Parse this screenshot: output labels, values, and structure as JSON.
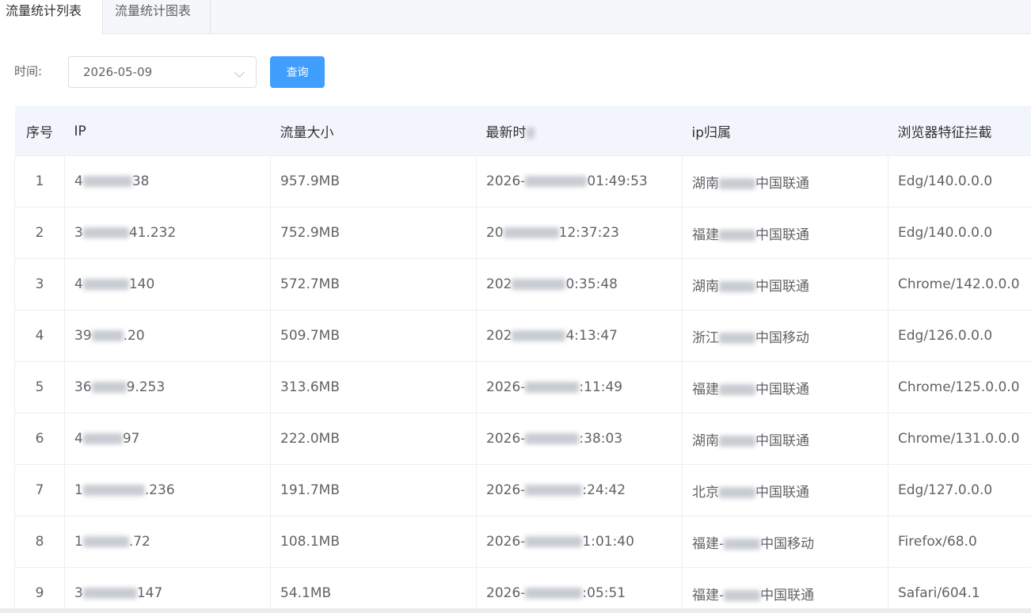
{
  "tabs": [
    {
      "label": "流量统计列表"
    },
    {
      "label": "流量统计图表"
    }
  ],
  "filter": {
    "time_label": "时间:",
    "date_value": "2026-05-09",
    "query_label": "查询"
  },
  "table": {
    "headers": [
      "序号",
      "IP",
      "流量大小",
      "最新时",
      "ip归属",
      "浏览器特征拦截"
    ],
    "rows": [
      {
        "index": "1",
        "ip_pre": "4",
        "ip_post": "38",
        "traffic": "957.9MB",
        "time_pre": "2026-",
        "time_post": "01:49:53",
        "region_pre": "湖南",
        "region_post": "中国联通",
        "browser": "Edg/140.0.0.0"
      },
      {
        "index": "2",
        "ip_pre": "3",
        "ip_post": "41.232",
        "traffic": "752.9MB",
        "time_pre": "20",
        "time_post": "12:37:23",
        "region_pre": "福建",
        "region_post": "中国联通",
        "browser": "Edg/140.0.0.0"
      },
      {
        "index": "3",
        "ip_pre": "4",
        "ip_post": "140",
        "traffic": "572.7MB",
        "time_pre": "202",
        "time_post": "0:35:48",
        "region_pre": "湖南",
        "region_post": "中国联通",
        "browser": "Chrome/142.0.0.0"
      },
      {
        "index": "4",
        "ip_pre": "39",
        "ip_post": ".20",
        "traffic": "509.7MB",
        "time_pre": "202",
        "time_post": "4:13:47",
        "region_pre": "浙江",
        "region_post": "中国移动",
        "browser": "Edg/126.0.0.0"
      },
      {
        "index": "5",
        "ip_pre": "36",
        "ip_post": "9.253",
        "traffic": "313.6MB",
        "time_pre": "2026-",
        "time_post": ":11:49",
        "region_pre": "福建",
        "region_post": "中国联通",
        "browser": "Chrome/125.0.0.0"
      },
      {
        "index": "6",
        "ip_pre": "4",
        "ip_post": "97",
        "traffic": "222.0MB",
        "time_pre": "2026-",
        "time_post": ":38:03",
        "region_pre": "湖南",
        "region_post": "中国联通",
        "browser": "Chrome/131.0.0.0"
      },
      {
        "index": "7",
        "ip_pre": "1",
        "ip_post": ".236",
        "traffic": "191.7MB",
        "time_pre": "2026-",
        "time_post": ":24:42",
        "region_pre": "北京",
        "region_post": "中国联通",
        "browser": "Edg/127.0.0.0"
      },
      {
        "index": "8",
        "ip_pre": "1",
        "ip_post": ".72",
        "traffic": "108.1MB",
        "time_pre": "2026-",
        "time_post": "1:01:40",
        "region_pre": "福建-",
        "region_post": "中国移动",
        "browser": "Firefox/68.0"
      },
      {
        "index": "9",
        "ip_pre": "3",
        "ip_post": "147",
        "traffic": "54.1MB",
        "time_pre": "2026-",
        "time_post": ":05:51",
        "region_pre": "福建-",
        "region_post": "中国联通",
        "browser": "Safari/604.1"
      }
    ]
  },
  "colors": {
    "primary": "#409eff",
    "header_bg": "#f2f6fc",
    "tab_bar_bg": "#f5f7fa"
  },
  "icons": {
    "date_dropdown": "chevron-down-icon"
  }
}
